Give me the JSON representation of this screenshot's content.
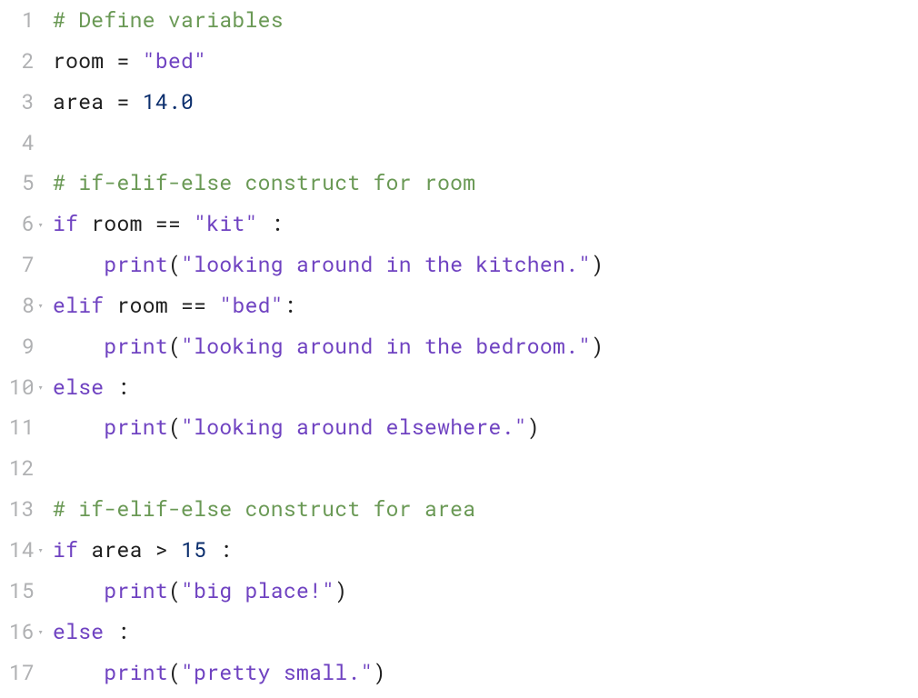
{
  "editor": {
    "language": "python",
    "lines": [
      {
        "n": 1,
        "fold": false,
        "tokens": [
          [
            "comment",
            "# Define variables"
          ]
        ]
      },
      {
        "n": 2,
        "fold": false,
        "tokens": [
          [
            "default",
            "room "
          ],
          [
            "operator",
            "="
          ],
          [
            "default",
            " "
          ],
          [
            "string",
            "\"bed\""
          ]
        ]
      },
      {
        "n": 3,
        "fold": false,
        "tokens": [
          [
            "default",
            "area "
          ],
          [
            "operator",
            "="
          ],
          [
            "default",
            " "
          ],
          [
            "number",
            "14.0"
          ]
        ]
      },
      {
        "n": 4,
        "fold": false,
        "tokens": []
      },
      {
        "n": 5,
        "fold": false,
        "tokens": [
          [
            "comment",
            "# if-elif-else construct for room"
          ]
        ]
      },
      {
        "n": 6,
        "fold": true,
        "tokens": [
          [
            "keyword",
            "if"
          ],
          [
            "default",
            " room "
          ],
          [
            "operator",
            "=="
          ],
          [
            "default",
            " "
          ],
          [
            "string",
            "\"kit\""
          ],
          [
            "default",
            " "
          ],
          [
            "operator",
            ":"
          ]
        ]
      },
      {
        "n": 7,
        "fold": false,
        "tokens": [
          [
            "indent",
            ""
          ],
          [
            "builtin",
            "print"
          ],
          [
            "default",
            "("
          ],
          [
            "string",
            "\"looking around in the kitchen.\""
          ],
          [
            "default",
            ")"
          ]
        ]
      },
      {
        "n": 8,
        "fold": true,
        "tokens": [
          [
            "keyword",
            "elif"
          ],
          [
            "default",
            " room "
          ],
          [
            "operator",
            "=="
          ],
          [
            "default",
            " "
          ],
          [
            "string",
            "\"bed\""
          ],
          [
            "operator",
            ":"
          ]
        ]
      },
      {
        "n": 9,
        "fold": false,
        "tokens": [
          [
            "indent",
            ""
          ],
          [
            "builtin",
            "print"
          ],
          [
            "default",
            "("
          ],
          [
            "string",
            "\"looking around in the bedroom.\""
          ],
          [
            "default",
            ")"
          ]
        ]
      },
      {
        "n": 10,
        "fold": true,
        "tokens": [
          [
            "keyword",
            "else"
          ],
          [
            "default",
            " "
          ],
          [
            "operator",
            ":"
          ]
        ]
      },
      {
        "n": 11,
        "fold": false,
        "tokens": [
          [
            "indent",
            ""
          ],
          [
            "builtin",
            "print"
          ],
          [
            "default",
            "("
          ],
          [
            "string",
            "\"looking around elsewhere.\""
          ],
          [
            "default",
            ")"
          ]
        ]
      },
      {
        "n": 12,
        "fold": false,
        "tokens": []
      },
      {
        "n": 13,
        "fold": false,
        "tokens": [
          [
            "comment",
            "# if-elif-else construct for area"
          ]
        ]
      },
      {
        "n": 14,
        "fold": true,
        "tokens": [
          [
            "keyword",
            "if"
          ],
          [
            "default",
            " area "
          ],
          [
            "operator",
            ">"
          ],
          [
            "default",
            " "
          ],
          [
            "number",
            "15"
          ],
          [
            "default",
            " "
          ],
          [
            "operator",
            ":"
          ]
        ]
      },
      {
        "n": 15,
        "fold": false,
        "tokens": [
          [
            "indent",
            ""
          ],
          [
            "builtin",
            "print"
          ],
          [
            "default",
            "("
          ],
          [
            "string",
            "\"big place!\""
          ],
          [
            "default",
            ")"
          ]
        ]
      },
      {
        "n": 16,
        "fold": true,
        "tokens": [
          [
            "keyword",
            "else"
          ],
          [
            "default",
            " "
          ],
          [
            "operator",
            ":"
          ]
        ]
      },
      {
        "n": 17,
        "fold": false,
        "tokens": [
          [
            "indent",
            ""
          ],
          [
            "builtin",
            "print"
          ],
          [
            "default",
            "("
          ],
          [
            "string",
            "\"pretty small.\""
          ],
          [
            "default",
            ")"
          ]
        ]
      }
    ]
  },
  "colors": {
    "comment": "#6a9955",
    "string_keyword_builtin": "#6f42c1",
    "number": "#0b2e6d",
    "default": "#1f1f1f",
    "gutter": "#b0b1b3"
  }
}
